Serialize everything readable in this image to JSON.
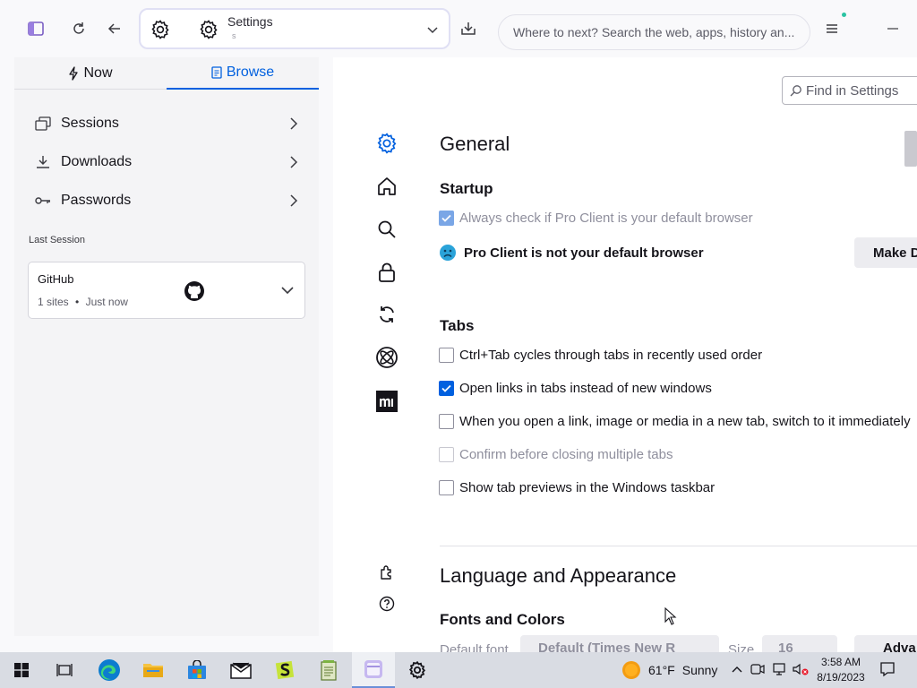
{
  "toolbar": {
    "url_title": "Settings",
    "url_subtitle": "s",
    "search_placeholder": "Where to next? Search the web, apps, history an..."
  },
  "sidebar": {
    "tabs": [
      {
        "label": "Now"
      },
      {
        "label": "Browse"
      }
    ],
    "items": [
      {
        "label": "Sessions"
      },
      {
        "label": "Downloads"
      },
      {
        "label": "Passwords"
      }
    ],
    "last_session_label": "Last Session",
    "session": {
      "title": "GitHub",
      "sites": "1 sites",
      "time": "Just now"
    }
  },
  "settings": {
    "find_placeholder": "Find in Settings",
    "general_title": "General",
    "startup_title": "Startup",
    "always_check_label": "Always check if Pro Client is your default browser",
    "not_default_label": "Pro Client is not your default browser",
    "make_default_label": "Make D",
    "tabs_title": "Tabs",
    "tab_options": [
      {
        "label": "Ctrl+Tab cycles through tabs in recently used order",
        "checked": false
      },
      {
        "label": "Open links in tabs instead of new windows",
        "checked": true
      },
      {
        "label": "When you open a link, image or media in a new tab, switch to it immediately",
        "checked": false
      },
      {
        "label": "Confirm before closing multiple tabs",
        "checked": false
      },
      {
        "label": "Show tab previews in the Windows taskbar",
        "checked": false
      }
    ],
    "language_title": "Language and Appearance",
    "fonts_title": "Fonts and Colors",
    "default_font_label": "Default font",
    "default_font_value": "Default (Times New R",
    "size_label": "Size",
    "size_value": "16",
    "advanced_label": "Adva"
  },
  "taskbar": {
    "temperature": "61°F",
    "condition": "Sunny",
    "time": "3:58 AM",
    "date": "8/19/2023"
  },
  "colors": {
    "accent": "#0060df",
    "sidebar_bg": "#f4f4f6",
    "taskbar_bg": "#d9dce3"
  }
}
